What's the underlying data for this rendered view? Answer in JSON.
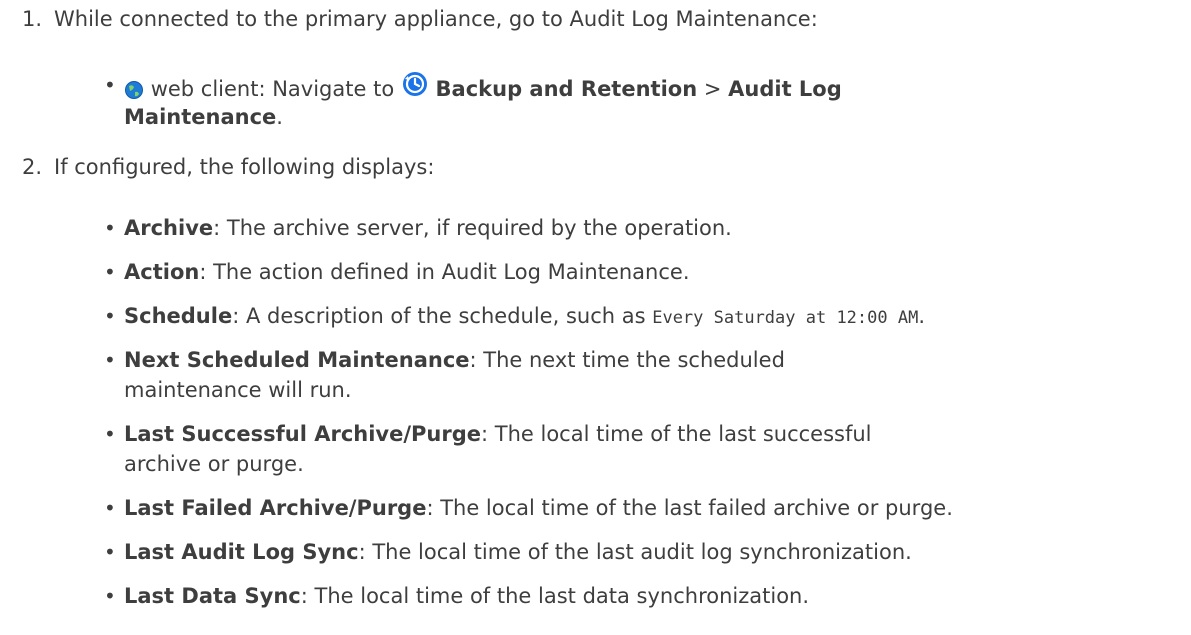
{
  "step1": {
    "number": "1.",
    "text": "While connected to the primary appliance, go to Audit Log Maintenance:",
    "sub": {
      "client_label": "web client: Navigate to",
      "nav1": "Backup and Retention",
      "separator": ">",
      "nav2_line1": "Audit Log",
      "nav2_line2": "Maintenance",
      "end": "."
    }
  },
  "step2": {
    "number": "2.",
    "text": "If configured, the following displays:",
    "items": [
      {
        "term": "Archive",
        "desc": ": The archive server, if required by the operation."
      },
      {
        "term": "Action",
        "desc": ": The action defined in Audit Log Maintenance."
      },
      {
        "term": "Schedule",
        "desc": ": A description of the schedule, such as ",
        "code": "Every Saturday at 12:00 AM",
        "end": "."
      },
      {
        "term": "Next Scheduled Maintenance",
        "desc": ": The next time the scheduled",
        "desc2": "maintenance will run."
      },
      {
        "term": "Last Successful Archive/Purge",
        "desc": ": The local time of the last successful",
        "desc2": "archive or purge."
      },
      {
        "term": "Last Failed Archive/Purge",
        "desc": ": The local time of the last failed archive or purge."
      },
      {
        "term": "Last Audit Log Sync",
        "desc": ": The local time of the last audit log synchronization."
      },
      {
        "term": "Last Data Sync",
        "desc": ": The local time of the last data synchronization."
      }
    ]
  },
  "icons": {
    "globe": "globe-icon",
    "backup": "backup-retention-icon"
  },
  "colors": {
    "text": "#3e3e3e",
    "globe_blue": "#1e7bd6",
    "backup_blue": "#1a73e8"
  }
}
